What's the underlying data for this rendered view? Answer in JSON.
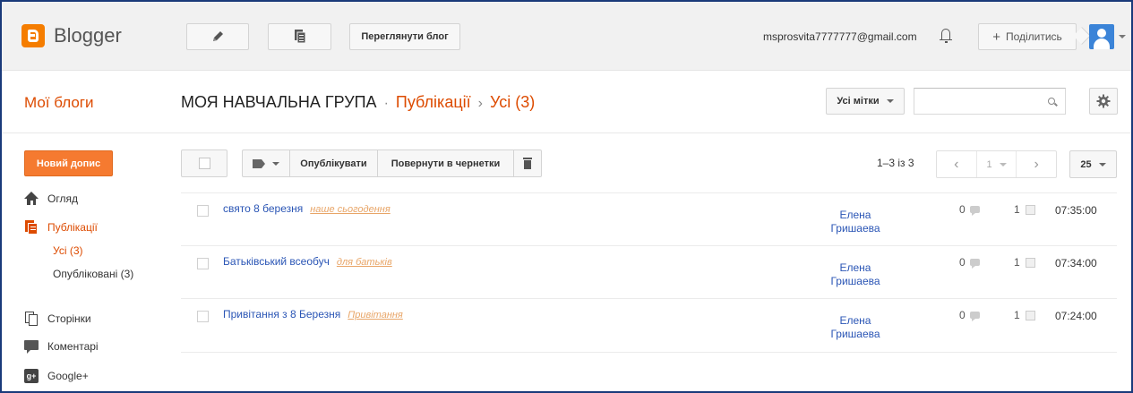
{
  "topbar": {
    "logo_text": "Blogger",
    "view_blog": "Переглянути блог",
    "email": "msprosvita7777777@gmail.com",
    "share": "Поділитись",
    "share_plus": "+"
  },
  "header": {
    "my_blogs": "Мої блоги",
    "blog_name": "МОЯ НАВЧАЛЬНА ГРУПА",
    "sep1": "·",
    "section": "Публікації",
    "sep2": "›",
    "filter": "Усі (3)",
    "labels_btn": "Усі мітки"
  },
  "sidebar": {
    "new_post": "Новий допис",
    "overview": "Огляд",
    "posts": "Публікації",
    "posts_all": "Усі (3)",
    "posts_published": "Опубліковані (3)",
    "pages": "Сторінки",
    "comments": "Коментарі",
    "gplus": "Google+",
    "gplus_icon_text": "g+"
  },
  "toolbar": {
    "publish": "Опублікувати",
    "revert": "Повернути в чернетки",
    "count": "1–3 із 3",
    "page": "1",
    "per_page": "25"
  },
  "posts": [
    {
      "title": "свято 8 березня",
      "label": "наше сьогодення",
      "author_first": "Елена",
      "author_last": "Гришаева",
      "comments": "0",
      "views": "1",
      "time": "07:35:00"
    },
    {
      "title": "Батьківський всеобуч",
      "label": "для батьків",
      "author_first": "Елена",
      "author_last": "Гришаева",
      "comments": "0",
      "views": "1",
      "time": "07:34:00"
    },
    {
      "title": "Привітання з 8 Березня",
      "label": "Привітання",
      "author_first": "Елена",
      "author_last": "Гришаева",
      "comments": "0",
      "views": "1",
      "time": "07:24:00"
    }
  ],
  "colors": {
    "accent": "#dd4b00",
    "link": "#2a55b5",
    "label": "#e8a567",
    "new_post_bg": "#f57a30"
  },
  "icons": {
    "logo": "blogger-logo-icon",
    "pencil": "pencil-icon",
    "copy": "copy-icon",
    "bell": "bell-icon",
    "search": "search-icon",
    "gear": "gear-icon",
    "tag": "tag-icon",
    "trash": "trash-icon"
  }
}
